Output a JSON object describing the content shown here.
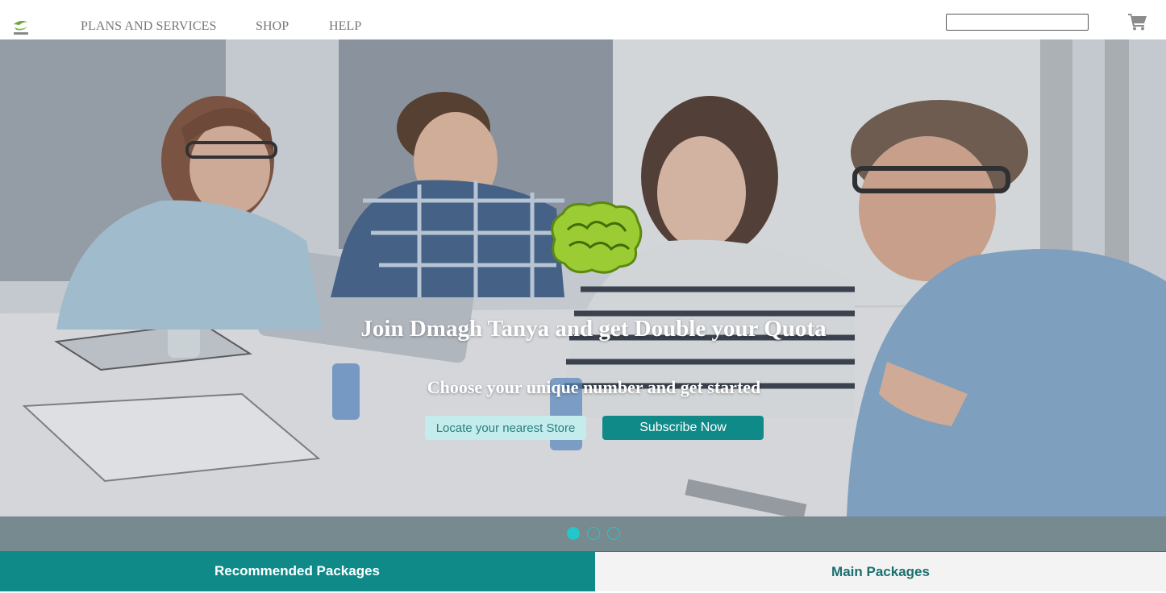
{
  "header": {
    "logo_icon": "etisalat-logo-icon",
    "nav": [
      {
        "label": "PLANS AND SERVICES"
      },
      {
        "label": "SHOP"
      },
      {
        "label": "HELP"
      }
    ],
    "search": {
      "placeholder": "",
      "value": ""
    },
    "cart_icon": "shopping-cart-icon"
  },
  "hero": {
    "badge_icon": "dmagh-tanya-brain-badge",
    "title": "Join Dmagh Tanya and get Double your Quota",
    "subtitle": "Choose your unique number and get started",
    "buttons": {
      "locate_label": "Locate your nearest Store",
      "subscribe_label": "Subscribe Now"
    }
  },
  "carousel": {
    "slide_count": 3,
    "active_index": 0
  },
  "tabs": [
    {
      "label": "Recommended Packages",
      "active": true
    },
    {
      "label": "Main Packages",
      "active": false
    }
  ],
  "colors": {
    "brand_teal": "#0f8a88",
    "indicator_cyan": "#23c6c9",
    "badge_green": "#9ccc34"
  }
}
